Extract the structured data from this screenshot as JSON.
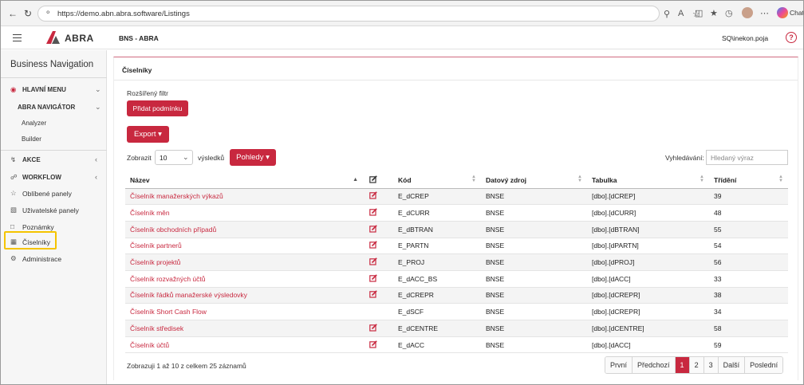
{
  "browser": {
    "url": "https://demo.abn.abra.software/Listings",
    "copilot_label": "Chat"
  },
  "header": {
    "brand": "ABRA",
    "company": "BNS - ABRA",
    "user": "SQ\\inekon.poja",
    "help": "?"
  },
  "sidebar": {
    "title": "Business Navigation",
    "main_menu": "HLAVNÍ MENU",
    "navigator": "ABRA NAVIGÁTOR",
    "analyzer": "Analyzer",
    "builder": "Builder",
    "actions": "AKCE",
    "workflow": "WORKFLOW",
    "favorites": "Oblíbené panely",
    "user_panels": "Uživatelské panely",
    "notes": "Poznámky",
    "listings": "Číselníky",
    "admin": "Administrace"
  },
  "content": {
    "title": "Číselníky",
    "filter_label": "Rozšířený filtr",
    "add_condition": "Přidat podmínku",
    "export": "Export",
    "show": "Zobrazit",
    "page_size": "10",
    "records": "výsledků",
    "views": "Pohledy",
    "search_label": "Vyhledávání:",
    "search_placeholder": "Hledaný výraz",
    "columns": [
      "Název",
      "Kód",
      "Datový zdroj",
      "Tabulka",
      "Třídění"
    ],
    "rows": [
      {
        "name": "Číselník manažerských výkazů",
        "edit": true,
        "code": "E_dCREP",
        "source": "BNSE",
        "table": "[dbo].[dCREP]",
        "order": "39"
      },
      {
        "name": "Číselník měn",
        "edit": true,
        "code": "E_dCURR",
        "source": "BNSE",
        "table": "[dbo].[dCURR]",
        "order": "48"
      },
      {
        "name": "Číselník obchodních případů",
        "edit": true,
        "code": "E_dBTRAN",
        "source": "BNSE",
        "table": "[dbo].[dBTRAN]",
        "order": "55"
      },
      {
        "name": "Číselník partnerů",
        "edit": true,
        "code": "E_PARTN",
        "source": "BNSE",
        "table": "[dbo].[dPARTN]",
        "order": "54"
      },
      {
        "name": "Číselník projektů",
        "edit": true,
        "code": "E_PROJ",
        "source": "BNSE",
        "table": "[dbo].[dPROJ]",
        "order": "56"
      },
      {
        "name": "Číselník rozvažných účtů",
        "edit": true,
        "code": "E_dACC_BS",
        "source": "BNSE",
        "table": "[dbo].[dACC]",
        "order": "33"
      },
      {
        "name": "Číselník řádků manažerské výsledovky",
        "edit": true,
        "code": "E_dCREPR",
        "source": "BNSE",
        "table": "[dbo].[dCREPR]",
        "order": "38"
      },
      {
        "name": "Číselník Short Cash Flow",
        "edit": false,
        "code": "E_dSCF",
        "source": "BNSE",
        "table": "[dbo].[dCREPR]",
        "order": "34"
      },
      {
        "name": "Číselník středisek",
        "edit": true,
        "code": "E_dCENTRE",
        "source": "BNSE",
        "table": "[dbo].[dCENTRE]",
        "order": "58"
      },
      {
        "name": "Číselník účtů",
        "edit": true,
        "code": "E_dACC",
        "source": "BNSE",
        "table": "[dbo].[dACC]",
        "order": "59"
      }
    ],
    "info": "Zobrazuji 1 až 10 z celkem 25 záznamů",
    "pager": {
      "first": "První",
      "prev": "Předchozí",
      "p1": "1",
      "p2": "2",
      "p3": "3",
      "next": "Další",
      "last": "Poslední"
    }
  },
  "colors": {
    "accent": "#c8283f",
    "highlight": "#f5c400"
  }
}
